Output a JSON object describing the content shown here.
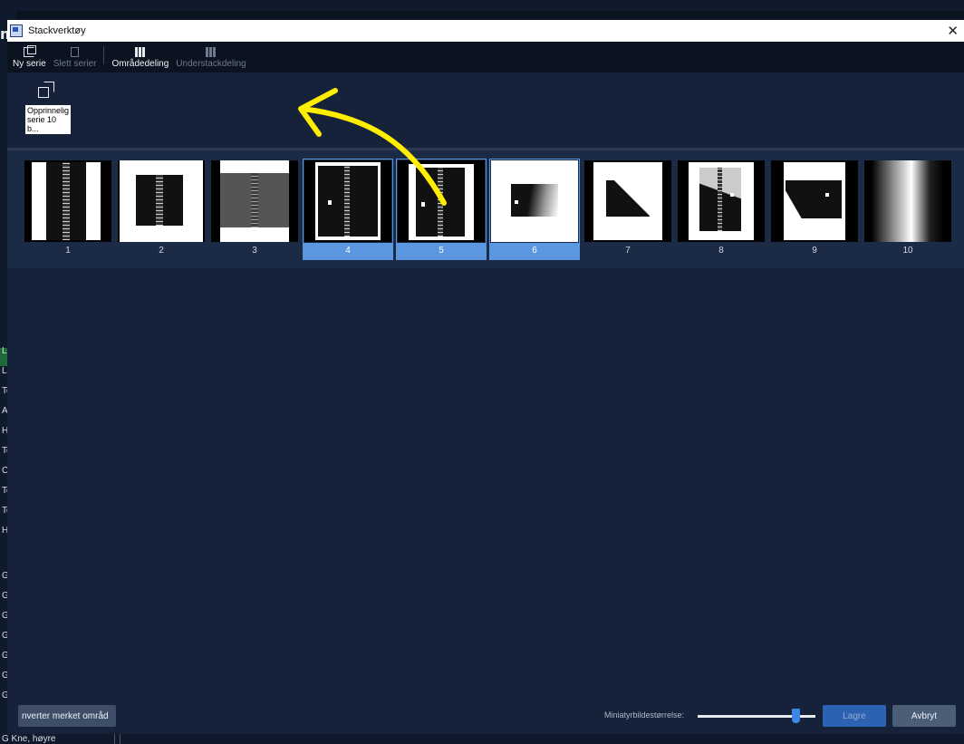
{
  "background_app": {
    "left_fragments": [
      "Lu",
      "Lä",
      "To",
      "Ar",
      "Ha",
      "To",
      "Cl",
      "To",
      "To",
      "Hc",
      "G I",
      "G I",
      "G",
      "G",
      "G",
      "G",
      "G"
    ],
    "m_letter": "m",
    "bottom_text": "G Kne, høyre"
  },
  "dialog": {
    "title": "Stackverktøy",
    "close_glyph": "✕"
  },
  "toolbar": {
    "new_series": "Ny serie",
    "delete_series": "Slett serier",
    "area_split": "Områdedeling",
    "substack_split": "Understackdeling"
  },
  "series": {
    "caption": "Opprinnelig serie 10 b..."
  },
  "thumbnails": [
    {
      "label": "1",
      "selected": false
    },
    {
      "label": "2",
      "selected": false
    },
    {
      "label": "3",
      "selected": false
    },
    {
      "label": "4",
      "selected": true
    },
    {
      "label": "5",
      "selected": true
    },
    {
      "label": "6",
      "selected": true
    },
    {
      "label": "7",
      "selected": false
    },
    {
      "label": "8",
      "selected": false
    },
    {
      "label": "9",
      "selected": false
    },
    {
      "label": "10",
      "selected": false
    }
  ],
  "footer": {
    "invert_button": "nverter merket områd",
    "slider_label": "Miniatyrbildestørrelse:",
    "slider_value_fraction": 0.82,
    "save_button": "Lagre",
    "cancel_button": "Avbryt"
  },
  "colors": {
    "selection": "#5a97e0",
    "annotation_arrow": "#ffee00"
  }
}
